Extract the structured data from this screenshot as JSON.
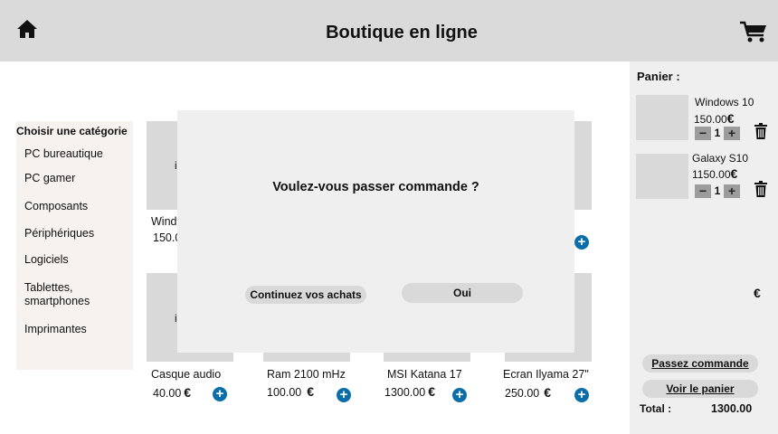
{
  "header": {
    "title": "Boutique en ligne",
    "home_icon": "home-icon",
    "cart_icon": "cart-icon"
  },
  "sidebar": {
    "title": "Choisir une catégorie",
    "categories": [
      "PC bureautique",
      "PC gamer",
      "Composants",
      "Périphériques",
      "Logiciels",
      "Tablettes, smartphones",
      "Imprimantes"
    ]
  },
  "products_top": [
    {
      "name_partial": "Wind",
      "price_partial": "150.0",
      "img_partial": "i"
    }
  ],
  "products_bottom": [
    {
      "name": "Casque audio",
      "price": "40.00",
      "img_partial": "i"
    },
    {
      "name": "Ram 2100 mHz",
      "price": "100.00"
    },
    {
      "name": "MSI Katana 17",
      "price": "1300.00"
    },
    {
      "name": "Ecran Ilyama 27\"",
      "price": "250.00"
    }
  ],
  "currency": "€",
  "modal": {
    "question": "Voulez-vous passer commande ?",
    "continue_label": "Continuez vos achats",
    "confirm_label": "Oui"
  },
  "cart": {
    "label": "Panier :",
    "items": [
      {
        "name": "Windows 10",
        "price": "150.00",
        "qty": "1"
      },
      {
        "name": "Galaxy S10",
        "price": "1150.00",
        "qty": "1"
      }
    ],
    "order_button": "Passez commande",
    "view_button": "Voir le panier",
    "total_label": "Total :",
    "total_value": "1300.00"
  },
  "colors": {
    "header_bg": "#dadada",
    "add_button": "#0b6ea8",
    "sidebar_bg": "#f6f2ef",
    "modal_bg": "#efefef"
  }
}
